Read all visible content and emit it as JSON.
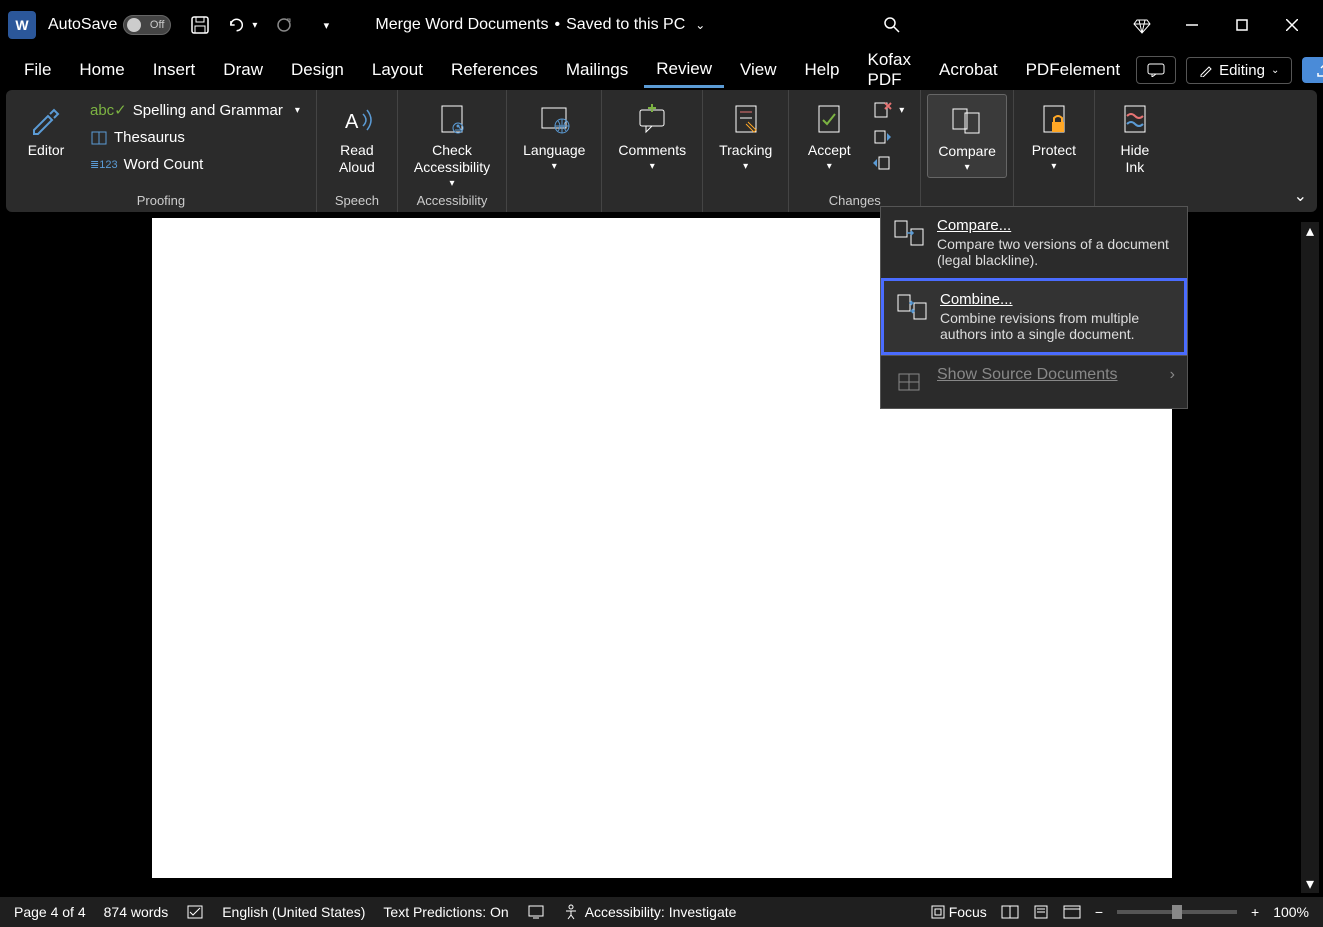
{
  "title_bar": {
    "autosave_label": "AutoSave",
    "autosave_state": "Off",
    "doc_name": "Merge Word Documents",
    "save_status": "Saved to this PC"
  },
  "tabs": [
    "File",
    "Home",
    "Insert",
    "Draw",
    "Design",
    "Layout",
    "References",
    "Mailings",
    "Review",
    "View",
    "Help",
    "Kofax PDF",
    "Acrobat",
    "PDFelement"
  ],
  "active_tab": "Review",
  "editing_label": "Editing",
  "ribbon": {
    "editor": "Editor",
    "spelling": "Spelling and Grammar",
    "thesaurus": "Thesaurus",
    "wordcount": "Word Count",
    "proofing_group": "Proofing",
    "read_aloud": "Read\nAloud",
    "speech_group": "Speech",
    "check_access": "Check\nAccessibility",
    "access_group": "Accessibility",
    "language": "Language",
    "comments": "Comments",
    "tracking": "Tracking",
    "accept": "Accept",
    "changes_group": "Changes",
    "compare": "Compare",
    "protect": "Protect",
    "hide_ink": "Hide\nInk"
  },
  "dropdown": {
    "compare_title": "Compare...",
    "compare_desc": "Compare two versions of a document (legal blackline).",
    "combine_title": "Combine...",
    "combine_desc": "Combine revisions from multiple authors into a single document.",
    "show_source": "Show Source Documents"
  },
  "status": {
    "page": "Page 4 of 4",
    "words": "874 words",
    "lang": "English (United States)",
    "predictions": "Text Predictions: On",
    "accessibility": "Accessibility: Investigate",
    "focus": "Focus",
    "zoom": "100%"
  }
}
